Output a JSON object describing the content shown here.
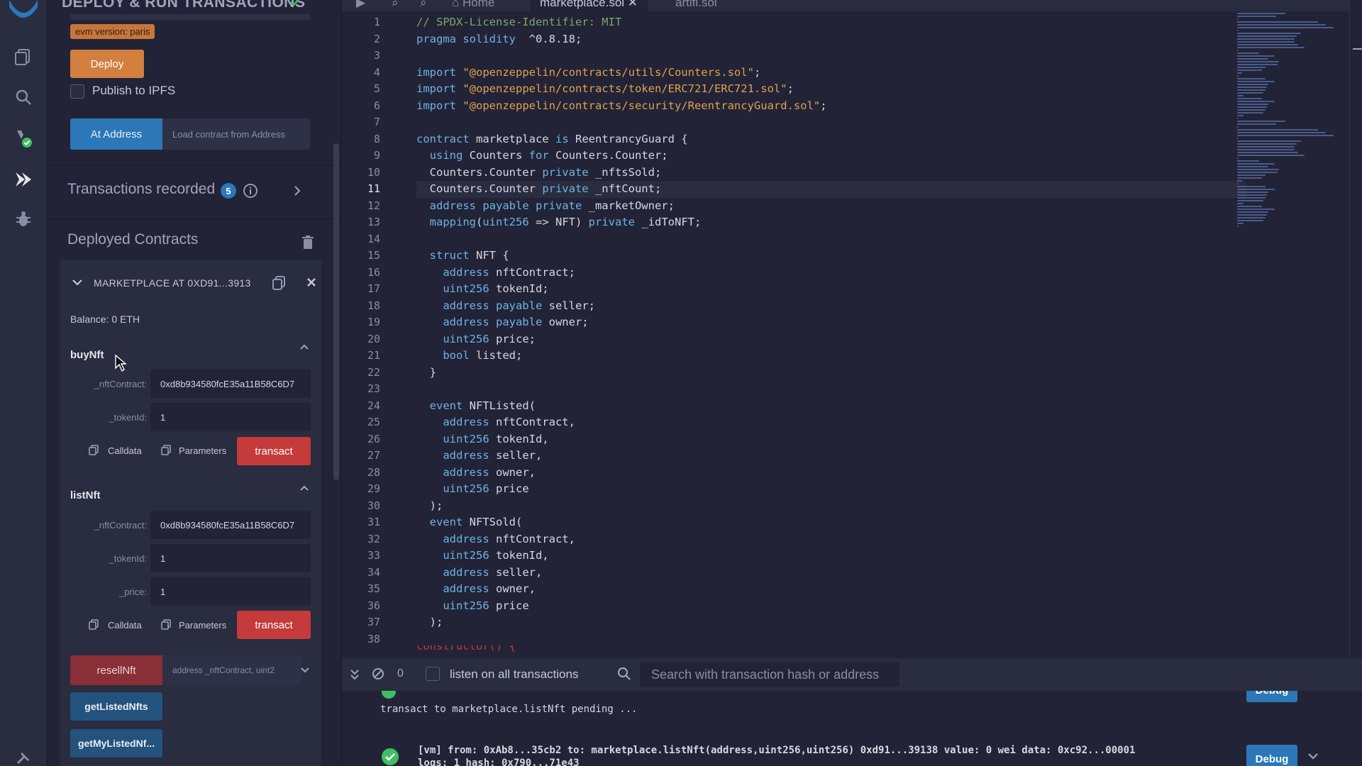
{
  "panel": {
    "title": "DEPLOY & RUN TRANSACTIONS",
    "evm_badge": "evm version: paris",
    "deploy_label": "Deploy",
    "publish_label": "Publish to IPFS",
    "at_address_label": "At Address",
    "load_placeholder": "Load contract from Address",
    "tx_recorded_label": "Transactions recorded",
    "tx_recorded_count": "5",
    "deployed_title": "Deployed Contracts",
    "instance_name": "MARKETPLACE AT 0XD91...3913",
    "balance": "Balance: 0 ETH",
    "functions": [
      {
        "name": "buyNft",
        "args": [
          {
            "label": "_nftContract:",
            "value": "0xd8b934580fcE35a11B58C6D7"
          },
          {
            "label": "_tokenId:",
            "value": "1"
          }
        ],
        "calldata_label": "Calldata",
        "params_label": "Parameters",
        "transact_label": "transact"
      },
      {
        "name": "listNft",
        "args": [
          {
            "label": "_nftContract:",
            "value": "0xd8b934580fcE35a11B58C6D7"
          },
          {
            "label": "_tokenId:",
            "value": "1"
          },
          {
            "label": "_price:",
            "value": "1"
          }
        ],
        "calldata_label": "Calldata",
        "params_label": "Parameters",
        "transact_label": "transact"
      }
    ],
    "resell_label": "resellNft",
    "resell_placeholder": "address _nftContract, uint2",
    "get_listed_label": "getListedNfts",
    "get_my_listed_label": "getMyListedNf..."
  },
  "tabs": [
    {
      "label": "Home"
    },
    {
      "label": "marketplace.sol"
    },
    {
      "label": "artifi.sol"
    }
  ],
  "editor": {
    "current_line": 11,
    "lines": [
      [
        [
          "c-com",
          "// SPDX-License-Identifier: MIT"
        ]
      ],
      [
        [
          "c-kw",
          "pragma solidity"
        ],
        [
          "",
          "  ^0.8.18;"
        ]
      ],
      [
        [
          "",
          ""
        ]
      ],
      [
        [
          "c-kw",
          "import"
        ],
        [
          "c-str",
          " \"@openzeppelin/contracts/utils/Counters.sol\""
        ],
        [
          "",
          ";"
        ]
      ],
      [
        [
          "c-kw",
          "import"
        ],
        [
          "c-str",
          " \"@openzeppelin/contracts/token/ERC721/ERC721.sol\""
        ],
        [
          "",
          ";"
        ]
      ],
      [
        [
          "c-kw",
          "import"
        ],
        [
          "c-str",
          " \"@openzeppelin/contracts/security/ReentrancyGuard.sol\""
        ],
        [
          "",
          ";"
        ]
      ],
      [
        [
          "",
          ""
        ]
      ],
      [
        [
          "c-kw",
          "contract"
        ],
        [
          "",
          " marketplace "
        ],
        [
          "c-kw",
          "is"
        ],
        [
          "",
          " ReentrancyGuard {"
        ]
      ],
      [
        [
          "",
          "  "
        ],
        [
          "c-kw",
          "using"
        ],
        [
          "",
          " Counters "
        ],
        [
          "c-kw",
          "for"
        ],
        [
          "",
          " Counters.Counter;"
        ]
      ],
      [
        [
          "",
          "  Counters.Counter "
        ],
        [
          "c-kw",
          "private"
        ],
        [
          "",
          " _nftsSold;"
        ]
      ],
      [
        [
          "",
          "  Counters.Counter "
        ],
        [
          "c-kw",
          "private"
        ],
        [
          "",
          " _nftCount;"
        ]
      ],
      [
        [
          "",
          "  "
        ],
        [
          "c-kw",
          "address payable private"
        ],
        [
          "",
          " _marketOwner;"
        ]
      ],
      [
        [
          "",
          "  "
        ],
        [
          "c-kw",
          "mapping"
        ],
        [
          "",
          "("
        ],
        [
          "c-kw",
          "uint256"
        ],
        [
          "",
          " => NFT) "
        ],
        [
          "c-kw",
          "private"
        ],
        [
          "",
          " _idToNFT;"
        ]
      ],
      [
        [
          "",
          ""
        ]
      ],
      [
        [
          "",
          "  "
        ],
        [
          "c-kw",
          "struct"
        ],
        [
          "",
          " NFT {"
        ]
      ],
      [
        [
          "",
          "    "
        ],
        [
          "c-kw",
          "address"
        ],
        [
          "",
          " nftContract;"
        ]
      ],
      [
        [
          "",
          "    "
        ],
        [
          "c-kw",
          "uint256"
        ],
        [
          "",
          " tokenId;"
        ]
      ],
      [
        [
          "",
          "    "
        ],
        [
          "c-kw",
          "address payable"
        ],
        [
          "",
          " seller;"
        ]
      ],
      [
        [
          "",
          "    "
        ],
        [
          "c-kw",
          "address payable"
        ],
        [
          "",
          " owner;"
        ]
      ],
      [
        [
          "",
          "    "
        ],
        [
          "c-kw",
          "uint256"
        ],
        [
          "",
          " price;"
        ]
      ],
      [
        [
          "",
          "    "
        ],
        [
          "c-kw",
          "bool"
        ],
        [
          "",
          " listed;"
        ]
      ],
      [
        [
          "",
          "  }"
        ]
      ],
      [
        [
          "",
          ""
        ]
      ],
      [
        [
          "",
          "  "
        ],
        [
          "c-kw",
          "event"
        ],
        [
          "",
          " NFTListed("
        ]
      ],
      [
        [
          "",
          "    "
        ],
        [
          "c-kw",
          "address"
        ],
        [
          "",
          " nftContract,"
        ]
      ],
      [
        [
          "",
          "    "
        ],
        [
          "c-kw",
          "uint256"
        ],
        [
          "",
          " tokenId,"
        ]
      ],
      [
        [
          "",
          "    "
        ],
        [
          "c-kw",
          "address"
        ],
        [
          "",
          " seller,"
        ]
      ],
      [
        [
          "",
          "    "
        ],
        [
          "c-kw",
          "address"
        ],
        [
          "",
          " owner,"
        ]
      ],
      [
        [
          "",
          "    "
        ],
        [
          "c-kw",
          "uint256"
        ],
        [
          "",
          " price"
        ]
      ],
      [
        [
          "",
          "  );"
        ]
      ],
      [
        [
          "",
          "  "
        ],
        [
          "c-kw",
          "event"
        ],
        [
          "",
          " NFTSold("
        ]
      ],
      [
        [
          "",
          "    "
        ],
        [
          "c-kw",
          "address"
        ],
        [
          "",
          " nftContract,"
        ]
      ],
      [
        [
          "",
          "    "
        ],
        [
          "c-kw",
          "uint256"
        ],
        [
          "",
          " tokenId,"
        ]
      ],
      [
        [
          "",
          "    "
        ],
        [
          "c-kw",
          "address"
        ],
        [
          "",
          " seller,"
        ]
      ],
      [
        [
          "",
          "    "
        ],
        [
          "c-kw",
          "address"
        ],
        [
          "",
          " owner,"
        ]
      ],
      [
        [
          "",
          "    "
        ],
        [
          "c-kw",
          "uint256"
        ],
        [
          "",
          " price"
        ]
      ],
      [
        [
          "",
          "  );"
        ]
      ],
      [
        [
          "",
          ""
        ]
      ]
    ]
  },
  "terminal": {
    "count": "0",
    "listen_label": "listen on all transactions",
    "search_placeholder": "Search with transaction hash or address",
    "pending": "transact to marketplace.listNft pending ...",
    "log_line1": "[vm] from: 0xAb8...35cb2 to: marketplace.listNft(address,uint256,uint256) 0xd91...39138 value: 0 wei data: 0xc92...00001",
    "log_line2": "logs: 1 hash: 0x790...71e43",
    "debug_label": "Debug"
  },
  "colors": {
    "accent_blue": "#2b77b8",
    "deploy_orange": "#d27f40",
    "transact_red": "#c53a3a",
    "success_green": "#3fbf62"
  }
}
